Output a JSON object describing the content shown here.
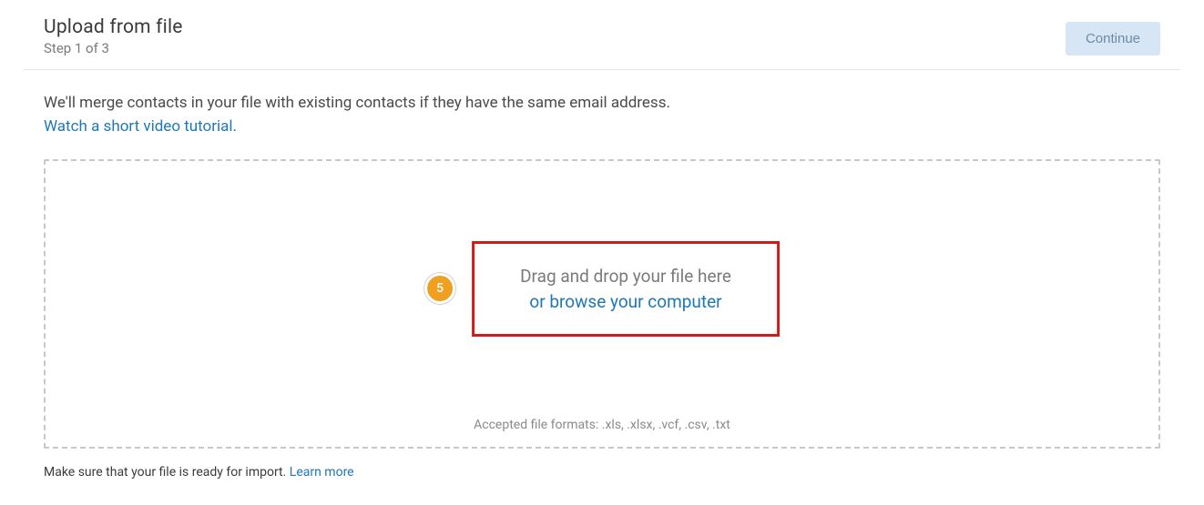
{
  "header": {
    "title": "Upload from file",
    "step_label": "Step 1 of 3",
    "continue_label": "Continue"
  },
  "info": {
    "merge_text": "We'll merge contacts in your file with existing contacts if they have the same email address.",
    "video_link_label": "Watch a short video tutorial."
  },
  "annotation": {
    "badge_number": "5"
  },
  "dropzone": {
    "drag_text": "Drag and drop your file here",
    "browse_text": "or browse your computer",
    "formats_text": "Accepted file formats: .xls, .xlsx, .vcf, .csv, .txt"
  },
  "footer": {
    "note_text": "Make sure that your file is ready for import. ",
    "learn_more_label": "Learn more"
  }
}
